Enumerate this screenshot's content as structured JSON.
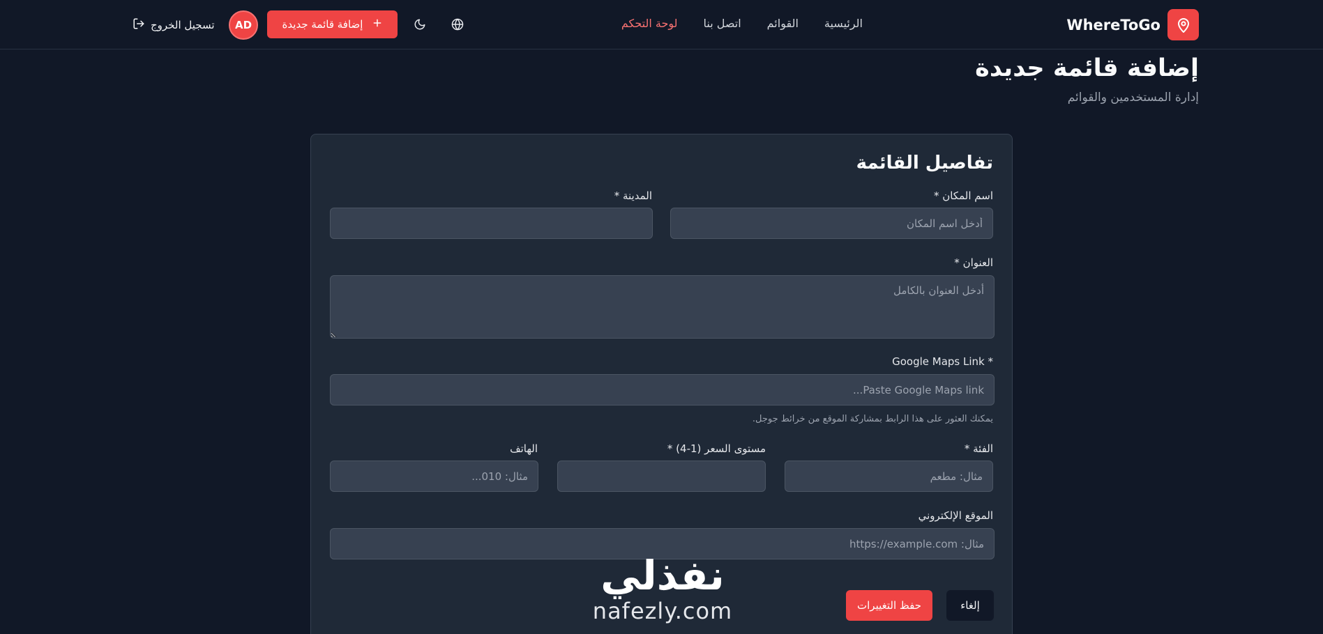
{
  "header": {
    "brand": "WhereToGo",
    "nav": [
      {
        "label": "الرئيسية",
        "active": false
      },
      {
        "label": "القوائم",
        "active": false
      },
      {
        "label": "اتصل بنا",
        "active": false
      },
      {
        "label": "لوحة التحكم",
        "active": true
      }
    ],
    "language_icon": "globe-icon",
    "theme_icon": "moon-icon",
    "add_listing_label": "إضافة قائمة جديدة",
    "avatar_initials": "AD",
    "logout_label": "تسجيل الخروج"
  },
  "page": {
    "title": "إضافة قائمة جديدة",
    "subtitle": "إدارة المستخدمين والقوائم"
  },
  "form": {
    "title": "تفاصيل القائمة",
    "place_name": {
      "label": "اسم المكان *",
      "placeholder": "أدخل اسم المكان",
      "value": ""
    },
    "city": {
      "label": "المدينة *",
      "value": ""
    },
    "address": {
      "label": "العنوان *",
      "placeholder": "أدخل العنوان بالكامل",
      "value": ""
    },
    "maps_link": {
      "label": "Google Maps Link *",
      "placeholder": "Paste Google Maps link...",
      "value": "",
      "hint": "يمكنك العثور على هذا الرابط بمشاركة الموقع من خرائط جوجل."
    },
    "category": {
      "label": "الفئة *",
      "placeholder": "مثال: مطعم",
      "value": ""
    },
    "price_level": {
      "label": "مستوى السعر (1-4) *",
      "value": ""
    },
    "phone": {
      "label": "الهاتف",
      "placeholder": "مثال: 010...",
      "value": ""
    },
    "website": {
      "label": "الموقع الإلكتروني",
      "placeholder": "مثال: https://example.com",
      "value": ""
    },
    "save_label": "حفظ التغييرات",
    "cancel_label": "إلغاء"
  },
  "watermark": {
    "arabic": "نفذلي",
    "latin": "nafezly.com"
  },
  "colors": {
    "background": "#111827",
    "card": "#1f2937",
    "accent": "#ef4444",
    "active_nav": "#f87171"
  }
}
